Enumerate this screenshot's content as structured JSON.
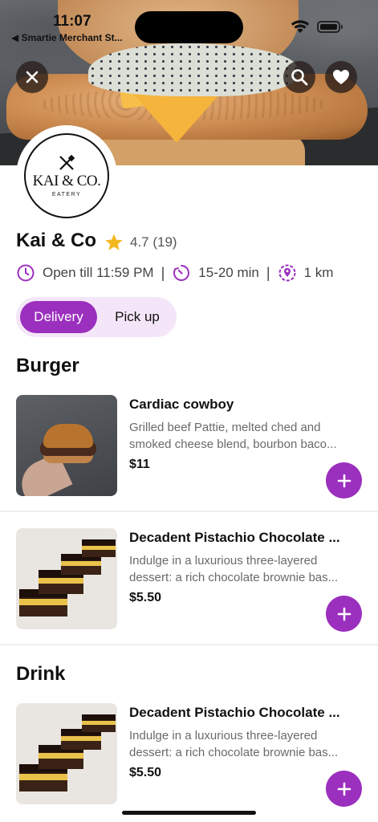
{
  "status_bar": {
    "time": "11:07",
    "back_label": "◀ Smartie Merchant St..."
  },
  "hero": {
    "close_icon": "close-icon",
    "search_icon": "search-icon",
    "favorite_icon": "heart-icon"
  },
  "logo": {
    "name": "KAI & CO.",
    "subtitle": "EATERY"
  },
  "restaurant": {
    "name": "Kai & Co",
    "rating": "4.7 (19)",
    "hours": "Open till 11:59 PM",
    "delivery_time": "15-20 min",
    "distance": "1 km"
  },
  "toggle": {
    "delivery": "Delivery",
    "pickup": "Pick up",
    "selected": "Delivery"
  },
  "sections": [
    {
      "title": "Burger",
      "items": [
        {
          "title": "Cardiac cowboy",
          "desc_line1": "Grilled beef Pattie, melted ched and",
          "desc_line2": "smoked cheese blend, bourbon baco...",
          "price": "$11"
        },
        {
          "title": "Decadent Pistachio Chocolate ...",
          "desc_line1": "Indulge in a luxurious three-layered",
          "desc_line2": "dessert: a rich chocolate brownie bas...",
          "price": "$5.50"
        }
      ]
    },
    {
      "title": "Drink",
      "items": [
        {
          "title": "Decadent Pistachio Chocolate ...",
          "desc_line1": "Indulge in a luxurious three-layered",
          "desc_line2": "dessert: a rich chocolate brownie bas...",
          "price": "$5.50"
        }
      ]
    }
  ],
  "colors": {
    "accent": "#9b2fbe",
    "accent_light": "#f4e6f8",
    "star": "#f2b81e"
  }
}
